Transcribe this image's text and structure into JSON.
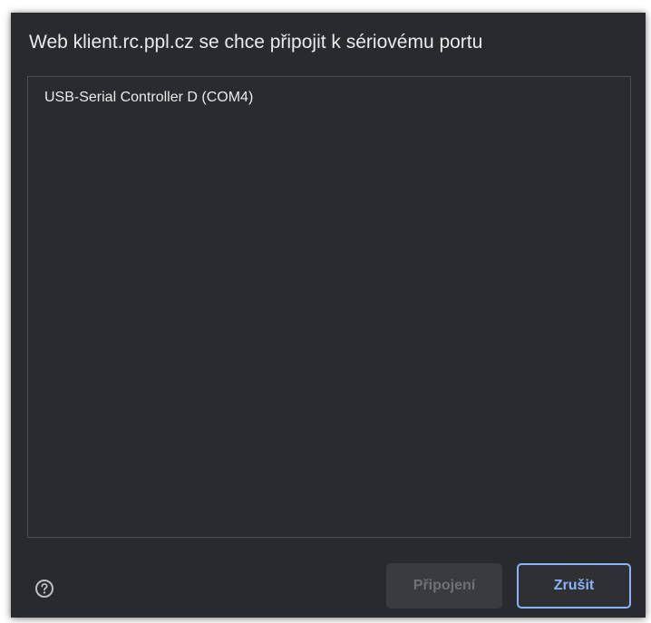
{
  "dialog": {
    "title": "Web klient.rc.ppl.cz se chce připojit k sériovému portu",
    "devices": [
      {
        "label": "USB-Serial Controller D (COM4)"
      }
    ],
    "buttons": {
      "connect_label": "Připojení",
      "connect_enabled": false,
      "cancel_label": "Zrušit"
    },
    "help_icon": "help-circle-icon",
    "colors": {
      "background": "#292a2d",
      "text": "#e8eaed",
      "accent": "#8ab4f8",
      "disabled_text": "#6f7175"
    }
  }
}
